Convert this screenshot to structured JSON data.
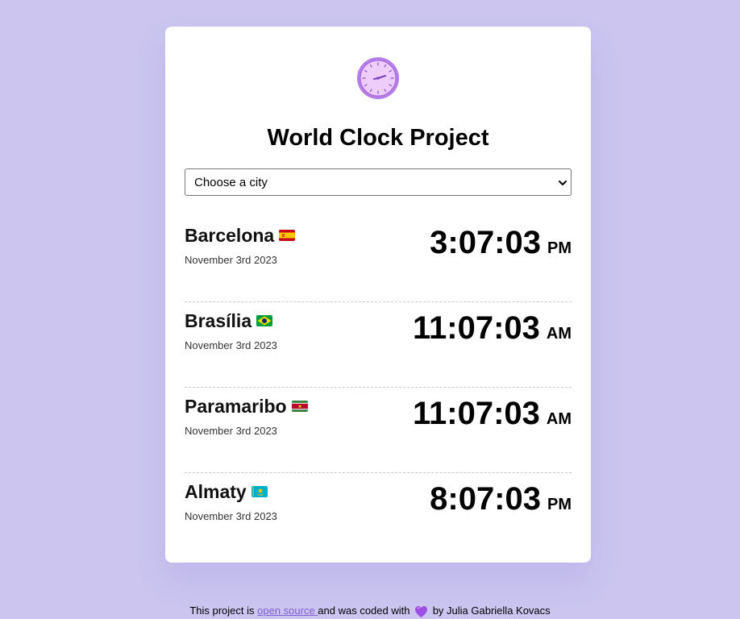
{
  "header": {
    "title": "World Clock Project"
  },
  "city_select": {
    "selected": "Choose a city"
  },
  "cities": [
    {
      "name": "Barcelona",
      "flag": "spain-flag",
      "date": "November 3rd 2023",
      "time": "3:07:03",
      "ampm": "PM"
    },
    {
      "name": "Brasília",
      "flag": "brazil-flag",
      "date": "November 3rd 2023",
      "time": "11:07:03",
      "ampm": "AM"
    },
    {
      "name": "Paramaribo",
      "flag": "suriname-flag",
      "date": "November 3rd 2023",
      "time": "11:07:03",
      "ampm": "AM"
    },
    {
      "name": "Almaty",
      "flag": "kazakhstan-flag",
      "date": "November 3rd 2023",
      "time": "8:07:03",
      "ampm": "PM"
    }
  ],
  "footer": {
    "prefix": "This project is ",
    "link": "open source ",
    "middle": " and was coded with ",
    "suffix": " by Julia Gabriella Kovacs"
  },
  "colors": {
    "background": "#cbc5f0",
    "card": "#ffffff",
    "link": "#7f5fd3",
    "accent": "#c77ff0"
  },
  "icons": {
    "logo": "clock-icon",
    "heart": "purple-heart-icon"
  }
}
